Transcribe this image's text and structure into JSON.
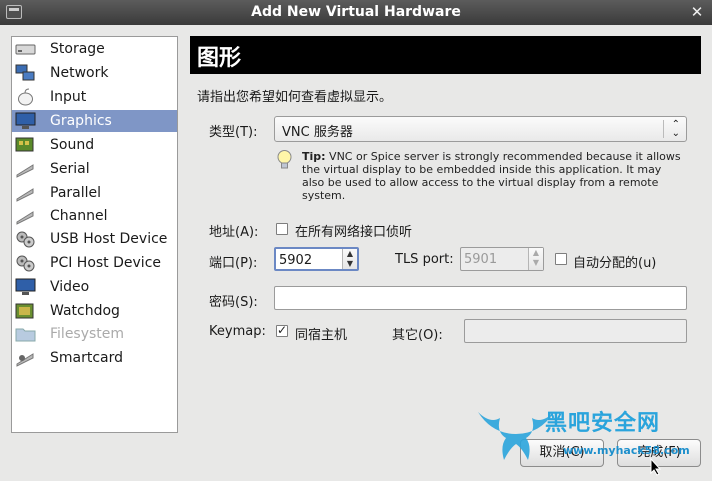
{
  "window": {
    "title": "Add New Virtual Hardware"
  },
  "sidebar": {
    "items": [
      {
        "label": "Storage",
        "icon": "storage-icon"
      },
      {
        "label": "Network",
        "icon": "network-icon"
      },
      {
        "label": "Input",
        "icon": "mouse-icon"
      },
      {
        "label": "Graphics",
        "icon": "monitor-icon",
        "selected": true
      },
      {
        "label": "Sound",
        "icon": "sound-card-icon"
      },
      {
        "label": "Serial",
        "icon": "serial-port-icon"
      },
      {
        "label": "Parallel",
        "icon": "parallel-port-icon"
      },
      {
        "label": "Channel",
        "icon": "channel-icon"
      },
      {
        "label": "USB Host Device",
        "icon": "gear-icon"
      },
      {
        "label": "PCI Host Device",
        "icon": "gear-icon"
      },
      {
        "label": "Video",
        "icon": "monitor-icon"
      },
      {
        "label": "Watchdog",
        "icon": "chip-icon"
      },
      {
        "label": "Filesystem",
        "icon": "folder-icon",
        "disabled": true
      },
      {
        "label": "Smartcard",
        "icon": "smartcard-icon"
      }
    ]
  },
  "page": {
    "heading": "图形",
    "description": "请指出您希望如何查看虚拟显示。",
    "type_label": "类型(T):",
    "type_value": "VNC 服务器",
    "tip_prefix": "Tip:",
    "tip_text": " VNC or Spice server is strongly recommended because it allows the virtual display to be embedded inside this application. It may also be used to allow access to the virtual display from a remote system.",
    "address_label": "地址(A):",
    "address_checkbox": "在所有网络接口侦听",
    "address_checked": false,
    "port_label": "端口(P):",
    "port_value": "5902",
    "tls_label": "TLS port:",
    "tls_value": "5901",
    "autoport_label": "自动分配的(u)",
    "autoport_checked": false,
    "password_label": "密码(S):",
    "password_value": "",
    "keymap_label": "Keymap:",
    "keymap_checkbox": "同宿主机",
    "keymap_checked": true,
    "other_label": "其它(O):",
    "other_value": ""
  },
  "buttons": {
    "cancel": "取消(C)",
    "finish": "完成(F)"
  },
  "watermark": {
    "text": "黑吧安全网",
    "url": "www.myhack58.com"
  },
  "colors": {
    "selection": "#7f96c6",
    "title_bar": "#3a3a3a",
    "watermark": "#2aa4dc"
  }
}
